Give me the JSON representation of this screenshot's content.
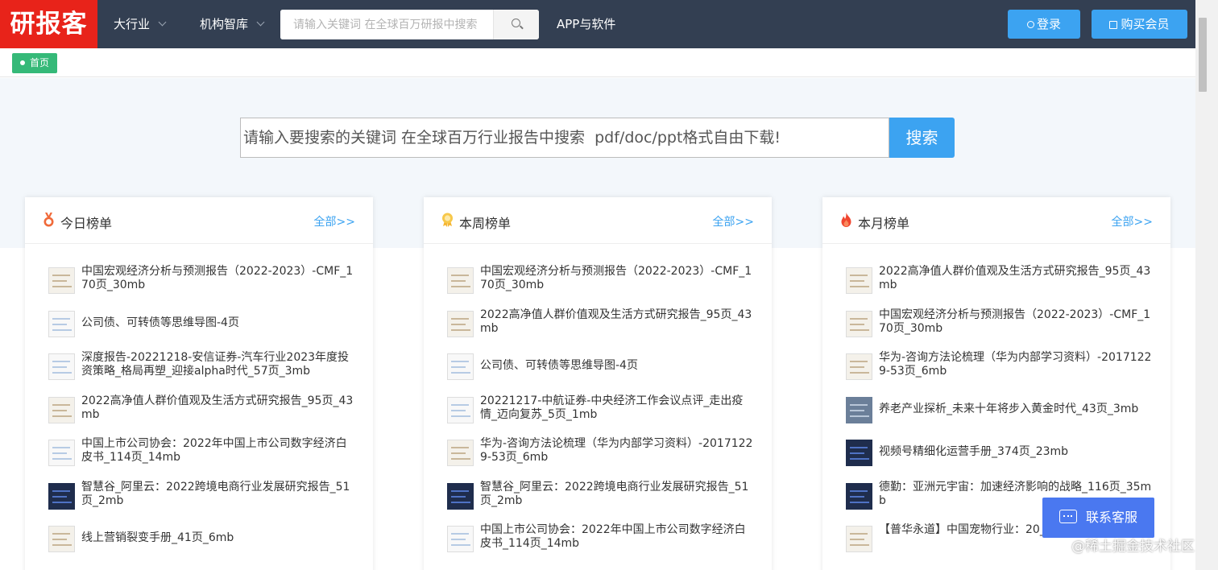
{
  "header": {
    "logo": "研报客",
    "nav": [
      {
        "label": "大行业",
        "has_dropdown": true
      },
      {
        "label": "机构智库",
        "has_dropdown": true
      },
      {
        "label": "APP与软件",
        "has_dropdown": false
      }
    ],
    "search_placeholder": "请输入关键词 在全球百万研报中搜索",
    "login_label": "登录",
    "buy_label": "购买会员",
    "accent_color": "#3ca3f1",
    "bar_color": "#333f52"
  },
  "breadcrumb": {
    "label": "首页"
  },
  "hero": {
    "search_placeholder": "请输入要搜索的关键词 在全球百万行业报告中搜索  pdf/doc/ppt格式自由下载!",
    "search_button": "搜索"
  },
  "rankings": [
    {
      "title": "今日榜单",
      "more": "全部>>",
      "items": [
        "中国宏观经济分析与预测报告（2022-2023）-CMF_170页_30mb",
        "公司债、可转债等思维导图-4页",
        "深度报告-20221218-安信证券-汽车行业2023年度投资策略_格局再塑_迎接alpha时代_57页_3mb",
        "2022高净值人群价值观及生活方式研究报告_95页_43mb",
        "中国上市公司协会：2022年中国上市公司数字经济白皮书_114页_14mb",
        "智慧谷_阿里云：2022跨境电商行业发展研究报告_51页_2mb",
        "线上营销裂变手册_41页_6mb"
      ]
    },
    {
      "title": "本周榜单",
      "more": "全部>>",
      "items": [
        "中国宏观经济分析与预测报告（2022-2023）-CMF_170页_30mb",
        "2022高净值人群价值观及生活方式研究报告_95页_43mb",
        "公司债、可转债等思维导图-4页",
        "20221217-中航证券-中央经济工作会议点评_走出疫情_迈向复苏_5页_1mb",
        "华为-咨询方法论梳理（华为内部学习资料）-20171229-53页_6mb",
        "智慧谷_阿里云：2022跨境电商行业发展研究报告_51页_2mb",
        "中国上市公司协会：2022年中国上市公司数字经济白皮书_114页_14mb"
      ]
    },
    {
      "title": "本月榜单",
      "more": "全部>>",
      "items": [
        "2022高净值人群价值观及生活方式研究报告_95页_43mb",
        "中国宏观经济分析与预测报告（2022-2023）-CMF_170页_30mb",
        "华为-咨询方法论梳理（华为内部学习资料）-20171229-53页_6mb",
        "养老产业探析_未来十年将步入黄金时代_43页_3mb",
        "视频号精细化运营手册_374页_23mb",
        "德勤：亚洲元宇宙：加速经济影响的战略_116页_35mb",
        "【普华永道】中国宠物行业：20__3mb"
      ]
    }
  ],
  "service_label": "联系客服",
  "watermark": "@稀土掘金技术社区"
}
